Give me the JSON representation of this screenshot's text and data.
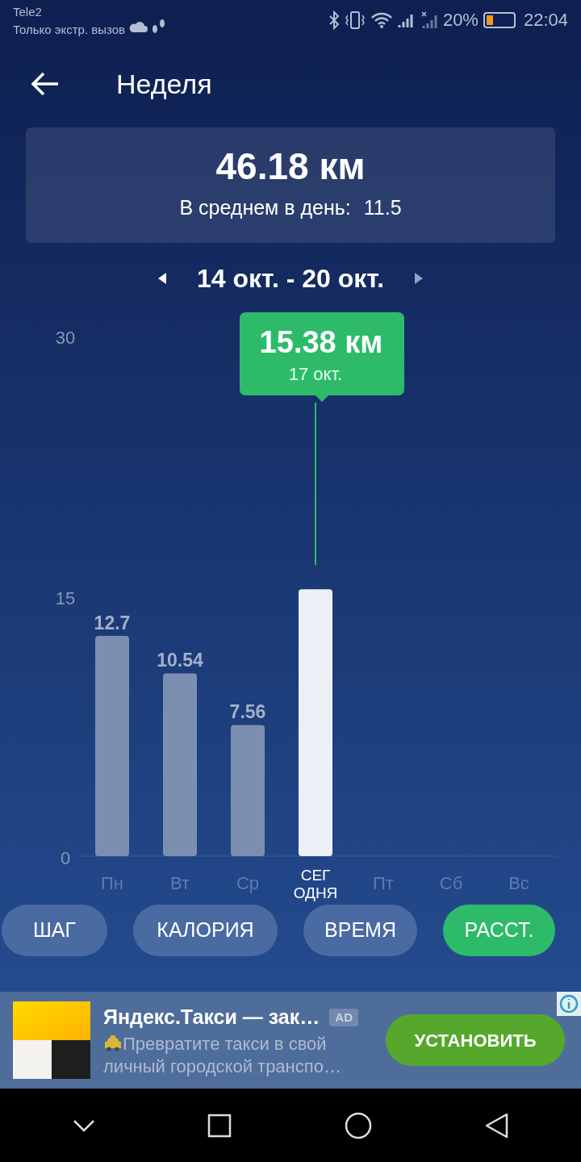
{
  "status_bar": {
    "carrier": "Tele2",
    "network_note": "Только экстр. вызов",
    "battery": "20%",
    "time": "22:04"
  },
  "header": {
    "title": "Неделя"
  },
  "summary": {
    "total": "46.18 км",
    "average_label": "В среднем в день:",
    "average_value": "11.5"
  },
  "period": {
    "label": "14 окт. - 20 окт."
  },
  "chart_data": {
    "type": "bar",
    "categories": [
      "Пн",
      "Вт",
      "Ср",
      "СЕГОДНЯ",
      "Пт",
      "Сб",
      "Вс"
    ],
    "series": [
      {
        "color": "#7b8fb0",
        "values": [
          12.7,
          10.54,
          7.56,
          null,
          null,
          null,
          null
        ]
      },
      {
        "color": "#eceff5",
        "values": [
          null,
          null,
          null,
          15.38,
          null,
          null,
          null
        ]
      }
    ],
    "ylim": [
      0,
      30
    ],
    "yticks": [
      0,
      15,
      30
    ],
    "value_labels": [
      "12.7",
      "10.54",
      "7.56",
      null,
      null,
      null,
      null
    ]
  },
  "tooltip": {
    "value": "15.38 км",
    "date": "17 окт."
  },
  "metric_tabs": [
    {
      "label": "ШАГ",
      "selected": false
    },
    {
      "label": "КАЛОРИЯ",
      "selected": false
    },
    {
      "label": "ВРЕМЯ",
      "selected": false
    },
    {
      "label": "РАССТ.",
      "selected": true
    }
  ],
  "ad": {
    "title": "Яндекс.Такси — зак…",
    "badge": "AD",
    "text": "Превратите такси в свой личный городской транспо…",
    "button": "УСТАНОВИТЬ"
  }
}
